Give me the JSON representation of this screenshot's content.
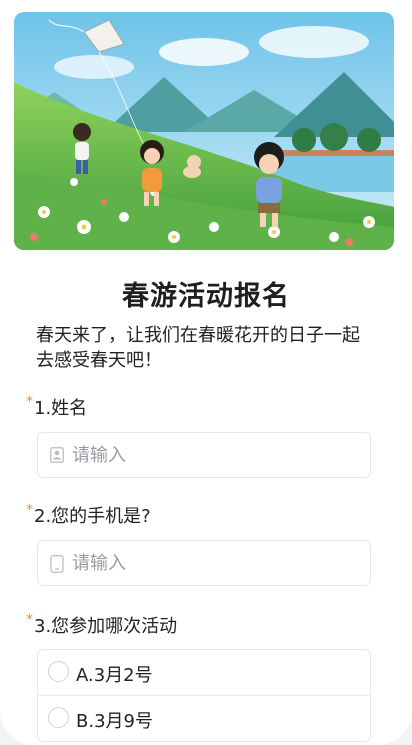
{
  "form": {
    "title": "春游活动报名",
    "description": "春天来了，让我们在春暖花开的日子一起去感受春天吧！",
    "required_mark": "*",
    "questions": [
      {
        "label": "1.姓名",
        "placeholder": "请输入",
        "icon": "person-icon"
      },
      {
        "label": "2.您的手机是?",
        "placeholder": "请输入",
        "icon": "phone-icon"
      },
      {
        "label": "3.您参加哪次活动",
        "options": [
          "A.3月2号",
          "B.3月9号"
        ]
      }
    ]
  },
  "banner": {
    "image": "spring-outing-illustration"
  }
}
